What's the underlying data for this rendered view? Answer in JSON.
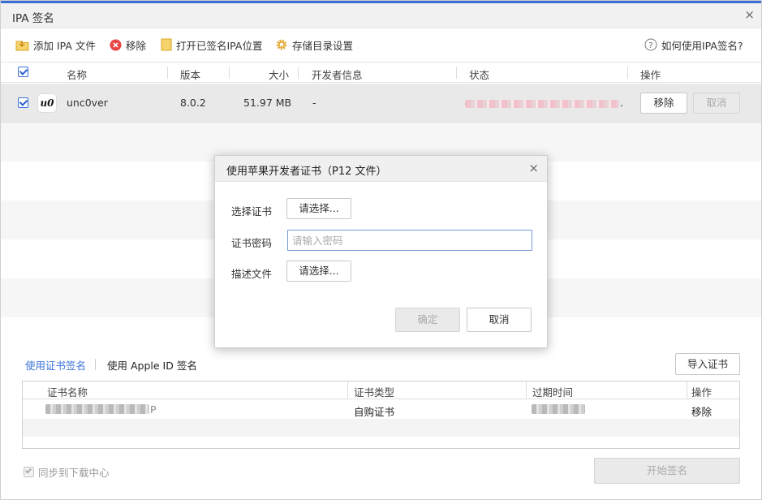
{
  "window": {
    "title": "IPA 签名",
    "close_glyph": "×",
    "accent": "#3c6fd6"
  },
  "toolbar": {
    "add_ipa": "添加 IPA 文件",
    "remove": "移除",
    "open_folder": "打开已签名IPA位置",
    "storage_settings": "存储目录设置",
    "help": "如何使用IPA签名?"
  },
  "table": {
    "headers": {
      "name": "名称",
      "version": "版本",
      "size": "大小",
      "developer": "开发者信息",
      "status": "状态",
      "actions": "操作"
    },
    "rows": [
      {
        "app_icon_text": "u0",
        "name": "unc0ver",
        "version": "8.0.2",
        "size": "51.97 MB",
        "developer": "-",
        "status_suffix": ".",
        "remove_label": "移除",
        "cancel_label": "取消"
      }
    ]
  },
  "dialog": {
    "title": "使用苹果开发者证书（P12 文件）",
    "close_glyph": "×",
    "cert_label": "选择证书",
    "cert_button": "请选择...",
    "password_label": "证书密码",
    "password_placeholder": "请输入密码",
    "profile_label": "描述文件",
    "profile_button": "请选择...",
    "ok_label": "确定",
    "cancel_label": "取消"
  },
  "bottom": {
    "tab_cert": "使用证书签名",
    "tab_appleid": "使用 Apple ID 签名",
    "import_cert": "导入证书",
    "cert_table": {
      "headers": {
        "name": "证书名称",
        "type": "证书类型",
        "expiry": "过期时间",
        "action": "操作"
      },
      "rows": [
        {
          "name_suffix": "P",
          "type": "自购证书",
          "action": "移除"
        }
      ]
    },
    "sync_label": "同步到下载中心",
    "start_sign": "开始签名"
  }
}
